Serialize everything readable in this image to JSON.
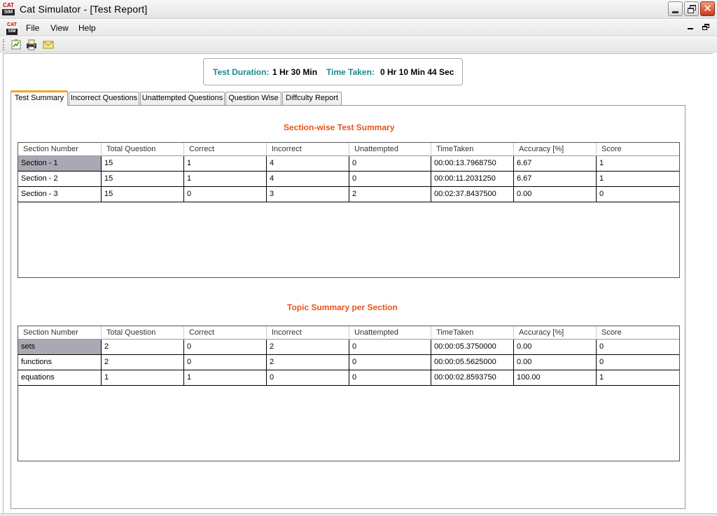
{
  "window": {
    "title": "Cat Simulator - [Test Report]",
    "logo_top": "CAT",
    "logo_bottom": "SIM"
  },
  "menu": {
    "file": "File",
    "view": "View",
    "help": "Help"
  },
  "toolbar": {
    "icons": [
      "report-icon",
      "print-icon",
      "mail-icon"
    ]
  },
  "duration": {
    "duration_label": "Test Duration:",
    "duration_value": "1 Hr 30 Min",
    "taken_label": "Time Taken:",
    "taken_value": "0 Hr 10 Min 44 Sec"
  },
  "tabs": [
    "Test Summary",
    "Incorrect Questions",
    "Unattempted Questions",
    "Question Wise",
    "Diffculty Report"
  ],
  "active_tab": "Test Summary",
  "columns": [
    "Section Number",
    "Total Question",
    "Correct",
    "Incorrect",
    "Unattempted",
    "TimeTaken",
    "Accuracy [%]",
    "Score"
  ],
  "section_summary": {
    "title": "Section-wise Test Summary",
    "rows": [
      [
        "Section - 1",
        "15",
        "1",
        "4",
        "0",
        "00:00:13.7968750",
        "6.67",
        "1"
      ],
      [
        "Section - 2",
        "15",
        "1",
        "4",
        "0",
        "00:00:11.2031250",
        "6.67",
        "1"
      ],
      [
        "Section - 3",
        "15",
        "0",
        "3",
        "2",
        "00:02:37.8437500",
        "0.00",
        "0"
      ]
    ]
  },
  "topic_summary": {
    "title": "Topic Summary per Section",
    "rows": [
      [
        "sets",
        "2",
        "0",
        "2",
        "0",
        "00:00:05.3750000",
        "0.00",
        "0"
      ],
      [
        "functions",
        "2",
        "0",
        "2",
        "0",
        "00:00:05.5625000",
        "0.00",
        "0"
      ],
      [
        "equations",
        "1",
        "1",
        "0",
        "0",
        "00:00:02.8593750",
        "100.00",
        "1"
      ]
    ]
  },
  "colors": {
    "accent_title": "#e8541a",
    "label_teal": "#1b8a8a",
    "tab_highlight": "#f5a623",
    "selected_cell": "#a9a9b3"
  }
}
